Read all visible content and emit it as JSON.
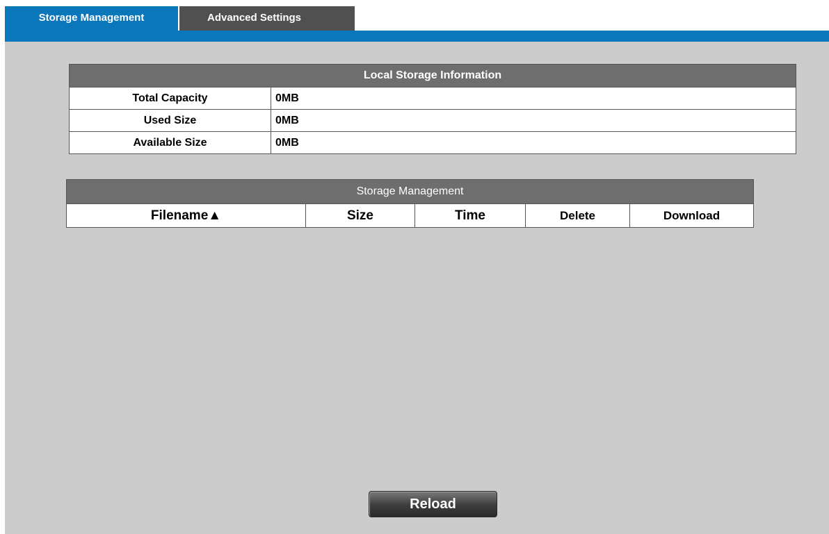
{
  "tabs": [
    {
      "label": "Storage Management",
      "active": true
    },
    {
      "label": "Advanced Settings",
      "active": false
    }
  ],
  "colors": {
    "accent": "#0a77bb",
    "header_bg": "#6e6e6e",
    "content_bg": "#cccccc",
    "inactive_tab": "#505050"
  },
  "local_storage": {
    "title": "Local Storage Information",
    "rows": [
      {
        "label": "Total Capacity",
        "value": "0MB"
      },
      {
        "label": "Used Size",
        "value": "0MB"
      },
      {
        "label": "Available Size",
        "value": "0MB"
      }
    ]
  },
  "storage_management": {
    "title": "Storage Management",
    "columns": [
      {
        "label": "Filename▲",
        "sort": "ascending"
      },
      {
        "label": "Size"
      },
      {
        "label": "Time"
      },
      {
        "label": "Delete"
      },
      {
        "label": "Download"
      }
    ],
    "rows": []
  },
  "reload_label": "Reload"
}
